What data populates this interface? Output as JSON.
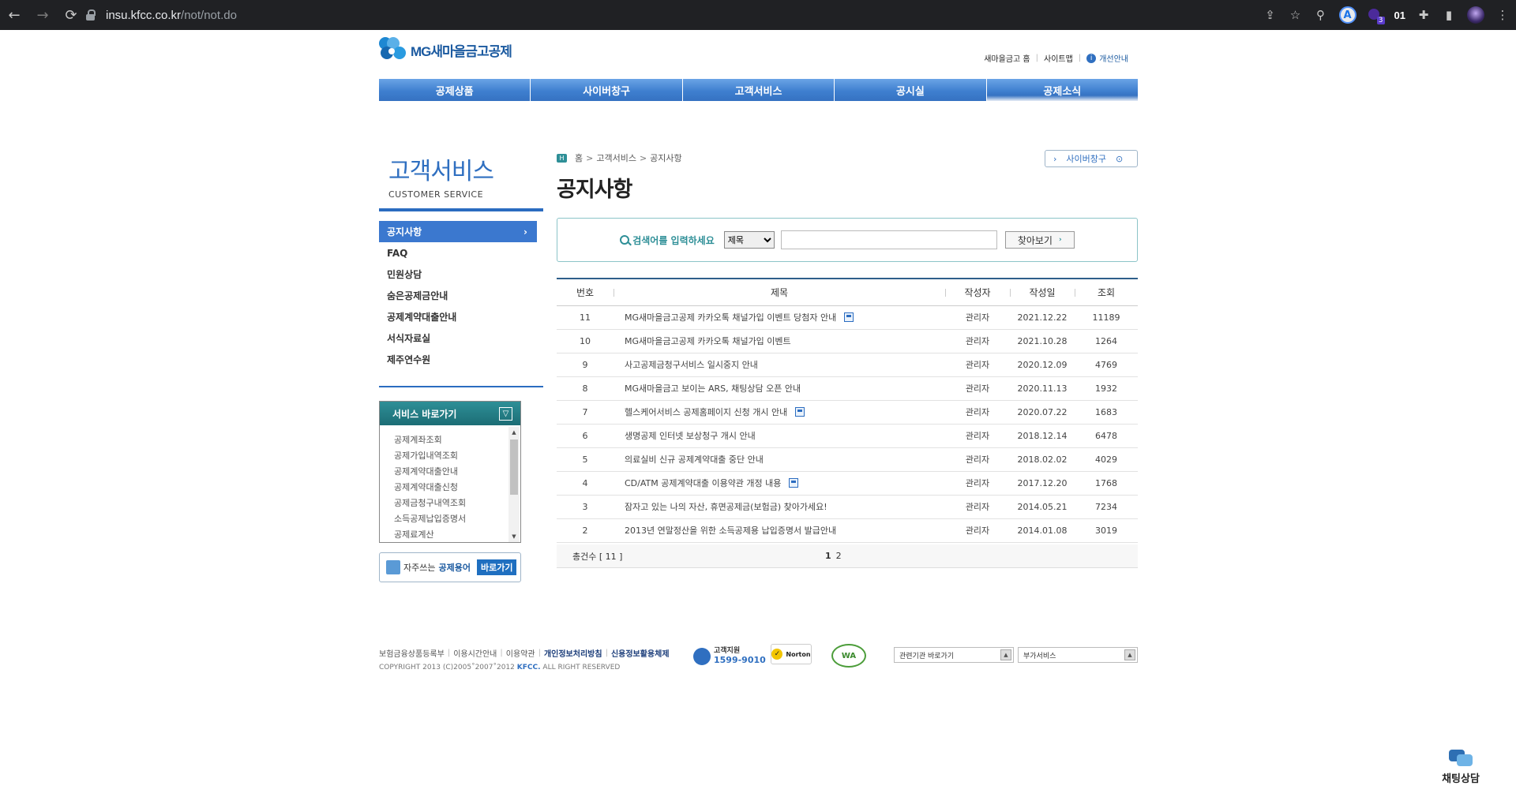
{
  "browser": {
    "url_host": "insu.kfcc.co.kr",
    "url_path": "/not/not.do",
    "profile_badge": "A",
    "ext_count": "3",
    "ext_text": "01"
  },
  "site": {
    "logo_text": "MG새마을금고공제",
    "util": {
      "home": "새마을금고 홈",
      "sitemap": "사이트맵",
      "improve": "개선안내"
    },
    "gnb": [
      "공제상품",
      "사이버창구",
      "고객서비스",
      "공시실",
      "공제소식"
    ]
  },
  "lnb": {
    "title_kr": "고객서비스",
    "title_en": "CUSTOMER SERVICE",
    "menu": [
      "공지사항",
      "FAQ",
      "민원상담",
      "숨은공제금안내",
      "공제계약대출안내",
      "서식자료실",
      "제주연수원"
    ],
    "service_title": "서비스 바로가기",
    "service_items": [
      "공제계좌조회",
      "공제가입내역조회",
      "공제계약대출안내",
      "공제계약대출신청",
      "공제금청구내역조회",
      "소득공제납입증명서",
      "공제료계산"
    ],
    "term_text": "자주쓰는",
    "term_bold": "공제용어",
    "term_go": "바로가기"
  },
  "content": {
    "breadcrumb": [
      "홈",
      "고객서비스",
      "공지사항"
    ],
    "cyber_btn": "사이버창구",
    "page_title": "공지사항",
    "search_label": "검색어를 입력하세요",
    "search_select": "제목",
    "search_btn": "찾아보기",
    "headers": [
      "번호",
      "제목",
      "작성자",
      "작성일",
      "조회"
    ],
    "rows": [
      {
        "no": "11",
        "title": "MG새마을금고공제 카카오톡 채널가입 이벤트 당첨자 안내",
        "writer": "관리자",
        "date": "2021.12.22",
        "views": "11189",
        "file": true
      },
      {
        "no": "10",
        "title": "MG새마을금고공제 카카오톡 채널가입 이벤트",
        "writer": "관리자",
        "date": "2021.10.28",
        "views": "1264",
        "file": false
      },
      {
        "no": "9",
        "title": "사고공제금청구서비스 일시중지 안내",
        "writer": "관리자",
        "date": "2020.12.09",
        "views": "4769",
        "file": false
      },
      {
        "no": "8",
        "title": "MG새마을금고 보이는 ARS, 채팅상담 오픈 안내",
        "writer": "관리자",
        "date": "2020.11.13",
        "views": "1932",
        "file": false
      },
      {
        "no": "7",
        "title": "헬스케어서비스 공제홈페이지 신청 개시 안내",
        "writer": "관리자",
        "date": "2020.07.22",
        "views": "1683",
        "file": true
      },
      {
        "no": "6",
        "title": "생명공제 인터넷 보상청구 개시 안내",
        "writer": "관리자",
        "date": "2018.12.14",
        "views": "6478",
        "file": false
      },
      {
        "no": "5",
        "title": "의료실비 신규 공제계약대출 중단 안내",
        "writer": "관리자",
        "date": "2018.02.02",
        "views": "4029",
        "file": false
      },
      {
        "no": "4",
        "title": "CD/ATM 공제계약대출 이용약관 개정 내용",
        "writer": "관리자",
        "date": "2017.12.20",
        "views": "1768",
        "file": true
      },
      {
        "no": "3",
        "title": "잠자고 있는 나의 자산, 휴면공제금(보험금) 찾아가세요!",
        "writer": "관리자",
        "date": "2014.05.21",
        "views": "7234",
        "file": false
      },
      {
        "no": "2",
        "title": "2013년 연말정산을 위한 소득공제용 납입증명서 발급안내",
        "writer": "관리자",
        "date": "2014.01.08",
        "views": "3019",
        "file": false
      }
    ],
    "total_label": "총건수 [ 11 ]",
    "pages": [
      "1",
      "2"
    ]
  },
  "footer": {
    "links": [
      "보험금융상품등록부",
      "이용시간안내",
      "이용약관",
      "개인정보처리방침",
      "신용정보활용체제"
    ],
    "copyright_pre": "COPYRIGHT 2013 (C)2005˚2007˚2012",
    "copyright_k": "KFCC.",
    "copyright_post": "ALL RIGHT RESERVED",
    "cs_label": "고객지원",
    "cs_phone": "1599-9010",
    "norton": "Norton",
    "wa": "WA",
    "select1": "관련기관 바로가기",
    "select2": "부가서비스"
  },
  "chat": {
    "label": "채팅상담"
  }
}
